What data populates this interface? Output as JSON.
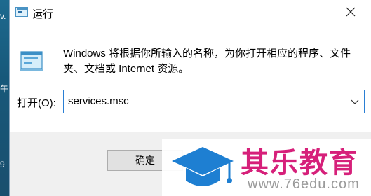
{
  "desktop": {
    "glyph_top": "v.",
    "glyph_mid": "午",
    "glyph_bottom": "9"
  },
  "dialog": {
    "title": "运行",
    "close_icon": "close-icon",
    "description": "Windows 将根据你所输入的名称，为你打开相应的程序、文件夹、文档或 Internet 资源。",
    "open_label": "打开(O):",
    "open_value": "services.msc",
    "ok_label": "确定"
  },
  "watermark": {
    "name": "其乐教育",
    "url": "www.76edu.com"
  },
  "colors": {
    "focus_border": "#2a7fd4",
    "watermark_brand": "#d6207a",
    "watermark_logo": "#1e7fd2",
    "button_bar": "#f0f0f0"
  }
}
